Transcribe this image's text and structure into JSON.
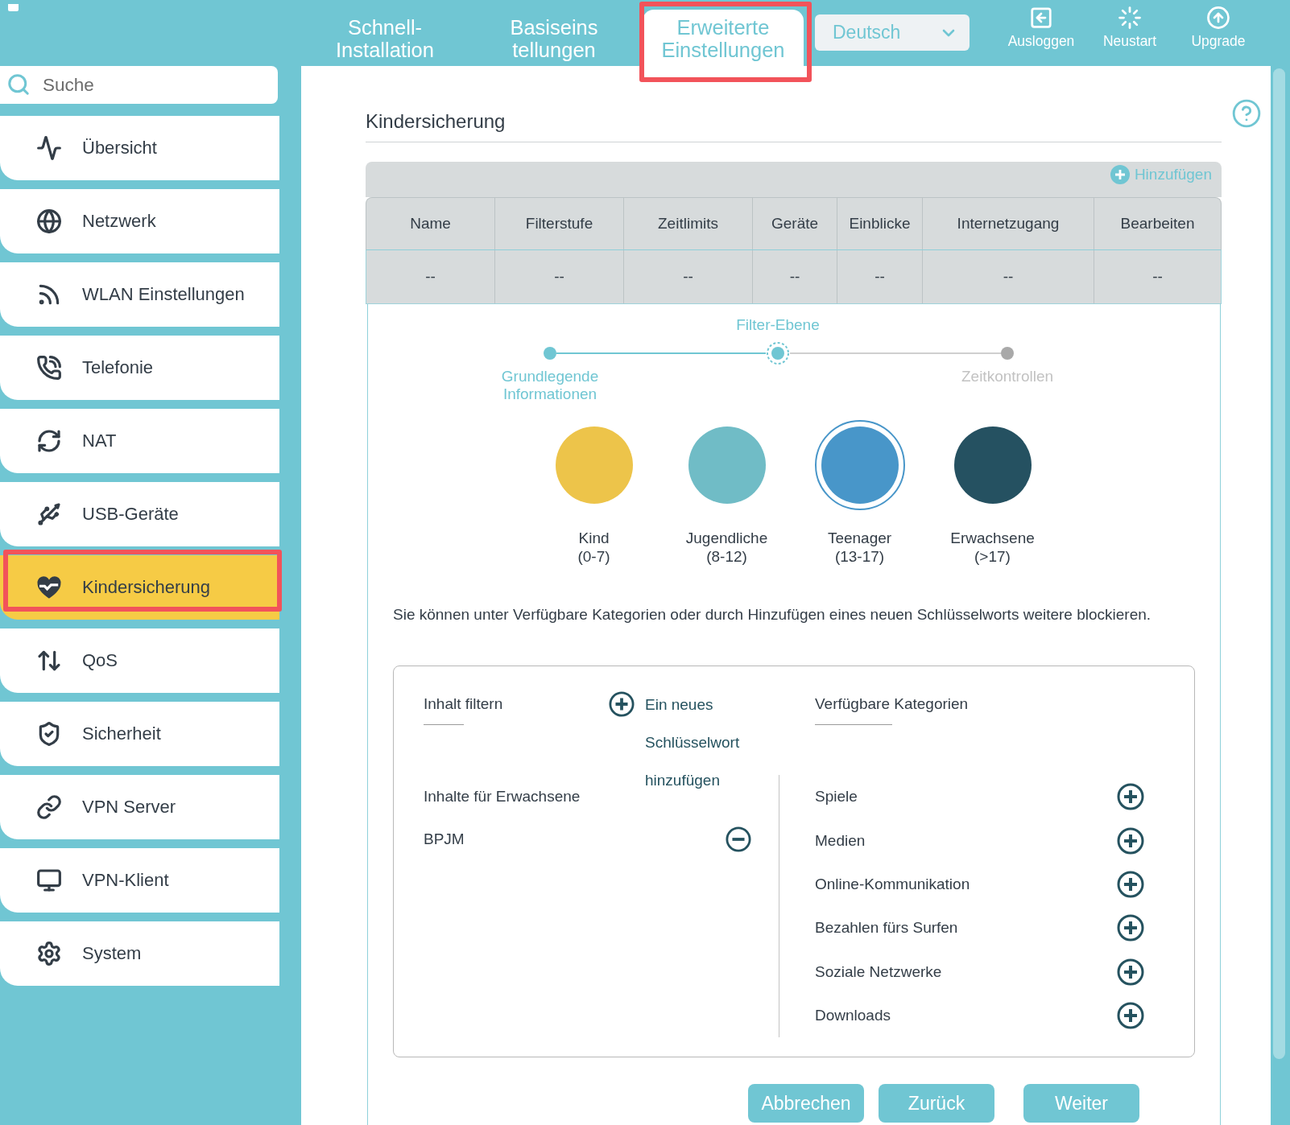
{
  "header": {
    "tabs": [
      {
        "label": "Schnell-\nInstallation",
        "selected": false,
        "highlighted": false
      },
      {
        "label": "Basiseins\ntellungen",
        "selected": false,
        "highlighted": false
      },
      {
        "label": "Erweiterte\nEinstellungen",
        "selected": true,
        "highlighted": true
      }
    ],
    "language": "Deutsch",
    "actions": [
      "Ausloggen",
      "Neustart",
      "Upgrade"
    ]
  },
  "sidebar": {
    "search": {
      "placeholder": "Suche"
    },
    "items": [
      {
        "label": "Übersicht",
        "selected": false,
        "highlighted": false
      },
      {
        "label": "Netzwerk",
        "selected": false,
        "highlighted": false
      },
      {
        "label": "WLAN Einstellungen",
        "selected": false,
        "highlighted": false
      },
      {
        "label": "Telefonie",
        "selected": false,
        "highlighted": false
      },
      {
        "label": "NAT",
        "selected": false,
        "highlighted": false
      },
      {
        "label": "USB-Geräte",
        "selected": false,
        "highlighted": false
      },
      {
        "label": "Kindersicherung",
        "selected": true,
        "highlighted": true
      },
      {
        "label": "QoS",
        "selected": false,
        "highlighted": false
      },
      {
        "label": "Sicherheit",
        "selected": false,
        "highlighted": false
      },
      {
        "label": "VPN Server",
        "selected": false,
        "highlighted": false
      },
      {
        "label": "VPN-Klient",
        "selected": false,
        "highlighted": false
      },
      {
        "label": "System",
        "selected": false,
        "highlighted": false
      }
    ]
  },
  "page_title": "Kindersicherung",
  "profiles_table": {
    "add_label": "Hinzufügen",
    "columns": [
      "Name",
      "Filterstufe",
      "Zeitlimits",
      "Geräte",
      "Einblicke",
      "Internetzugang",
      "Bearbeiten"
    ],
    "rows": [
      [
        "--",
        "--",
        "--",
        "--",
        "--",
        "--",
        "--"
      ]
    ]
  },
  "wizard": {
    "steps": [
      {
        "label": "Grundlegende Informationen",
        "done": true,
        "selected": false
      },
      {
        "label": "Filter-Ebene",
        "done": false,
        "selected": true
      },
      {
        "label": "Zeitkontrollen",
        "done": false,
        "selected": false
      }
    ],
    "filter_levels": [
      {
        "label": "Kind",
        "range": "(0-7)",
        "color": "#edc44a",
        "selected": false
      },
      {
        "label": "Jugendliche",
        "range": "(8-12)",
        "color": "#70bcc6",
        "selected": false
      },
      {
        "label": "Teenager",
        "range": "(13-17)",
        "color": "#4896c9",
        "selected": true
      },
      {
        "label": "Erwachsene",
        "range": "(>17)",
        "color": "#255161",
        "selected": false
      }
    ],
    "hint": "Sie können unter Verfügbare Kategorien oder durch Hinzufügen eines neuen Schlüsselworts weitere blockieren.",
    "filter_content": {
      "title": "Inhalt filtern",
      "add_keyword": "Ein neues Schlüsselwort hinzufügen",
      "items": [
        {
          "label": "Inhalte für Erwachsene",
          "removable": false
        },
        {
          "label": "BPJM",
          "removable": true
        }
      ]
    },
    "categories": {
      "title": "Verfügbare Kategorien",
      "items": [
        "Spiele",
        "Medien",
        "Online-Kommunikation",
        "Bezahlen fürs Surfen",
        "Soziale Netzwerke",
        "Downloads"
      ]
    },
    "buttons": [
      "Abbrechen",
      "Zurück",
      "Weiter"
    ]
  }
}
